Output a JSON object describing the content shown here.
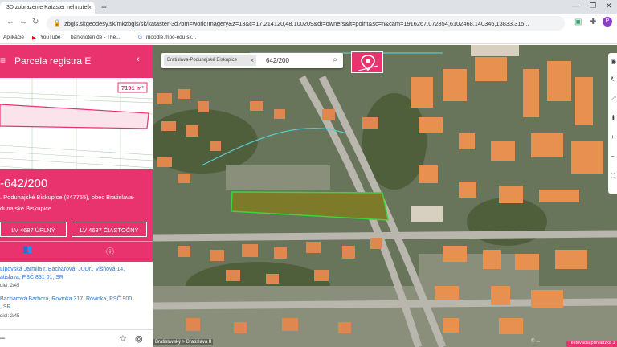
{
  "browser": {
    "tab_title": "3D zobrazenie Kataster nehnuteľ",
    "tab_close": "×",
    "new_tab": "+",
    "url": "zbgis.skgeodesy.sk/mkzbgis/sk/kataster-3d?bm=world!magery&z=13&c=17.214120,48.100209&dt=owners&it=point&sc=n&cam=1916267.072854,6102468.140346,13833.315...",
    "bookmarks": [
      "Aplikácie",
      "YouTube",
      "banknoten.de - The...",
      "moodle.mpc-edu.sk..."
    ]
  },
  "sidebar": {
    "title": "Parcela registra E",
    "area_badge": "7191 m²",
    "parcel_number": "-642/200",
    "location_line1": ". Podunajské Biskupice (847755), obec Bratislava-",
    "location_line2": "dunajské Biskupice",
    "btn_full": "LV 4687 ÚPLNÝ",
    "btn_partial": "LV 4687 ČIASTOČNÝ",
    "owners": [
      {
        "name": "Lipovská Jarmila r. Bachárová, JUDr., Višňová 14,",
        "address": "atislava, PSČ 831 01, SR",
        "share": "diel: 2/45"
      },
      {
        "name": "Bachárová Barbora, Rovinka 317, Rovinka, PSČ 900",
        "address": ", SR",
        "share": "diel: 2/45"
      }
    ]
  },
  "map": {
    "chip_label": "Bratislava-Podunajské Biskupice",
    "search_value": "642/200",
    "scale_label": "Bratislavský > Bratislava II",
    "copyright": "© ...",
    "test_label": "Testovacia prevádzka 3"
  },
  "colors": {
    "brand": "#e8336e",
    "link": "#2a77d6",
    "parcel_outline": "#39d639"
  }
}
